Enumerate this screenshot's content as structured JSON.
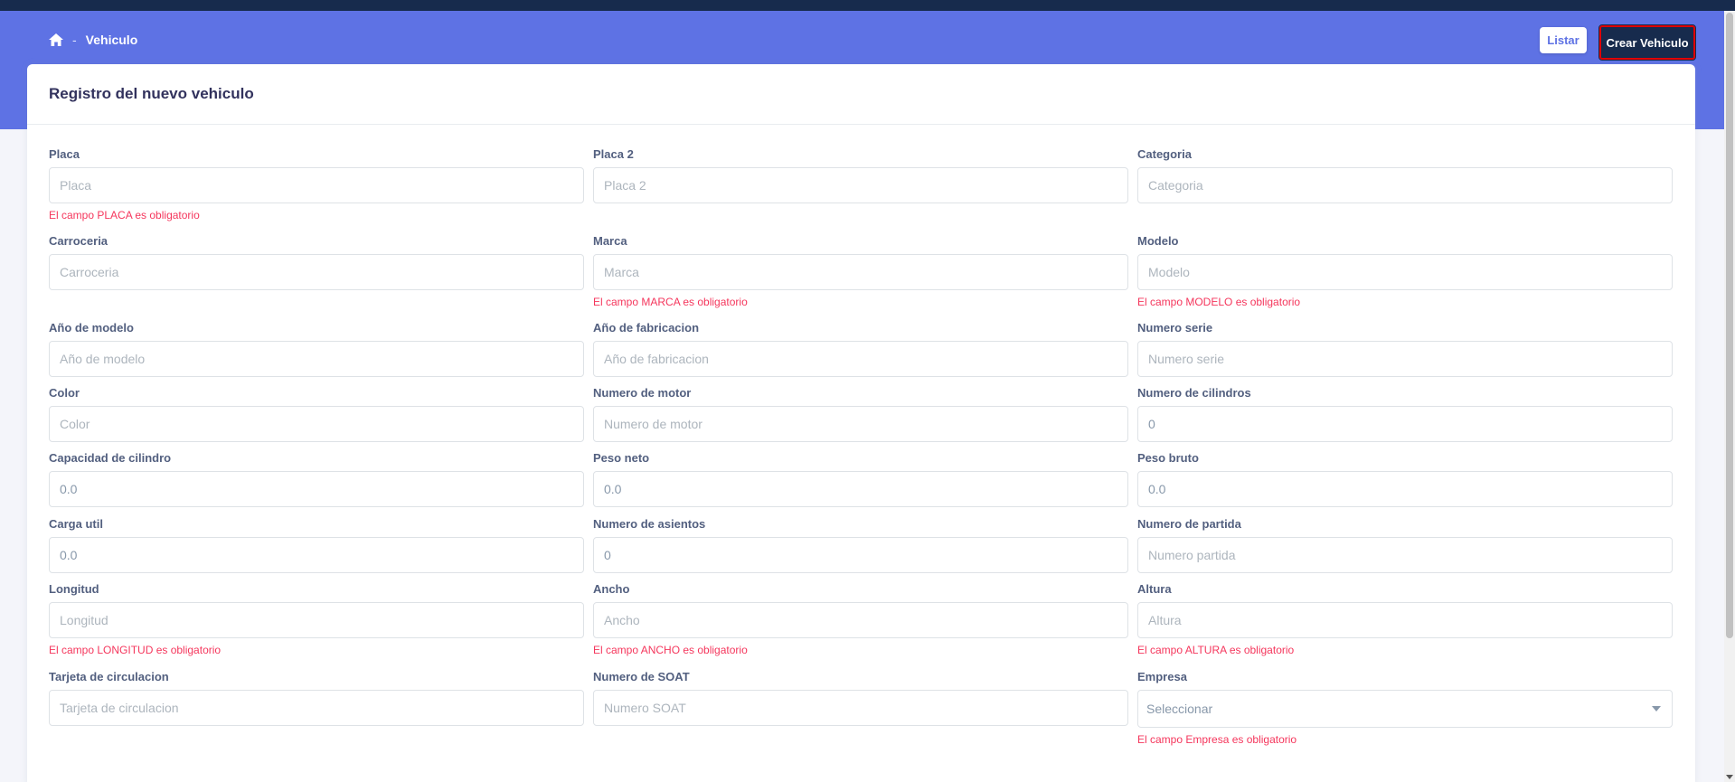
{
  "breadcrumb": {
    "home_icon": "home-icon",
    "separator": "-",
    "current": "Vehiculo"
  },
  "header": {
    "listar_label": "Listar",
    "crear_label": "Crear Vehiculo"
  },
  "card": {
    "title": "Registro del nuevo vehiculo"
  },
  "fields": {
    "placa": {
      "label": "Placa",
      "placeholder": "Placa",
      "value": "",
      "error": "El campo PLACA es obligatorio"
    },
    "placa2": {
      "label": "Placa 2",
      "placeholder": "Placa 2",
      "value": ""
    },
    "categoria": {
      "label": "Categoria",
      "placeholder": "Categoria",
      "value": ""
    },
    "carroceria": {
      "label": "Carroceria",
      "placeholder": "Carroceria",
      "value": ""
    },
    "marca": {
      "label": "Marca",
      "placeholder": "Marca",
      "value": "",
      "error": "El campo MARCA es obligatorio"
    },
    "modelo": {
      "label": "Modelo",
      "placeholder": "Modelo",
      "value": "",
      "error": "El campo MODELO es obligatorio"
    },
    "anio_modelo": {
      "label": "Año de modelo",
      "placeholder": "Año de modelo",
      "value": ""
    },
    "anio_fabricacion": {
      "label": "Año de fabricacion",
      "placeholder": "Año de fabricacion",
      "value": ""
    },
    "numero_serie": {
      "label": "Numero serie",
      "placeholder": "Numero serie",
      "value": ""
    },
    "color": {
      "label": "Color",
      "placeholder": "Color",
      "value": ""
    },
    "numero_motor": {
      "label": "Numero de motor",
      "placeholder": "Numero de motor",
      "value": ""
    },
    "numero_cilindros": {
      "label": "Numero de cilindros",
      "placeholder": "",
      "value": "0"
    },
    "capacidad_cilindro": {
      "label": "Capacidad de cilindro",
      "placeholder": "",
      "value": "0.0"
    },
    "peso_neto": {
      "label": "Peso neto",
      "placeholder": "",
      "value": "0.0"
    },
    "peso_bruto": {
      "label": "Peso bruto",
      "placeholder": "",
      "value": "0.0"
    },
    "carga_util": {
      "label": "Carga util",
      "placeholder": "",
      "value": "0.0"
    },
    "numero_asientos": {
      "label": "Numero de asientos",
      "placeholder": "",
      "value": "0"
    },
    "numero_partida": {
      "label": "Numero de partida",
      "placeholder": "Numero partida",
      "value": ""
    },
    "longitud": {
      "label": "Longitud",
      "placeholder": "Longitud",
      "value": "",
      "error": "El campo LONGITUD es obligatorio"
    },
    "ancho": {
      "label": "Ancho",
      "placeholder": "Ancho",
      "value": "",
      "error": "El campo ANCHO es obligatorio"
    },
    "altura": {
      "label": "Altura",
      "placeholder": "Altura",
      "value": "",
      "error": "El campo ALTURA es obligatorio"
    },
    "tarjeta_circulacion": {
      "label": "Tarjeta de circulacion",
      "placeholder": "Tarjeta de circulacion",
      "value": ""
    },
    "numero_soat": {
      "label": "Numero de SOAT",
      "placeholder": "Numero SOAT",
      "value": ""
    },
    "empresa": {
      "label": "Empresa",
      "selected": "Seleccionar",
      "error": "El campo Empresa es obligatorio"
    }
  },
  "colors": {
    "primary": "#5e72e4",
    "dark": "#172b4d",
    "error": "#f5365c",
    "highlight_border": "#e00000"
  }
}
